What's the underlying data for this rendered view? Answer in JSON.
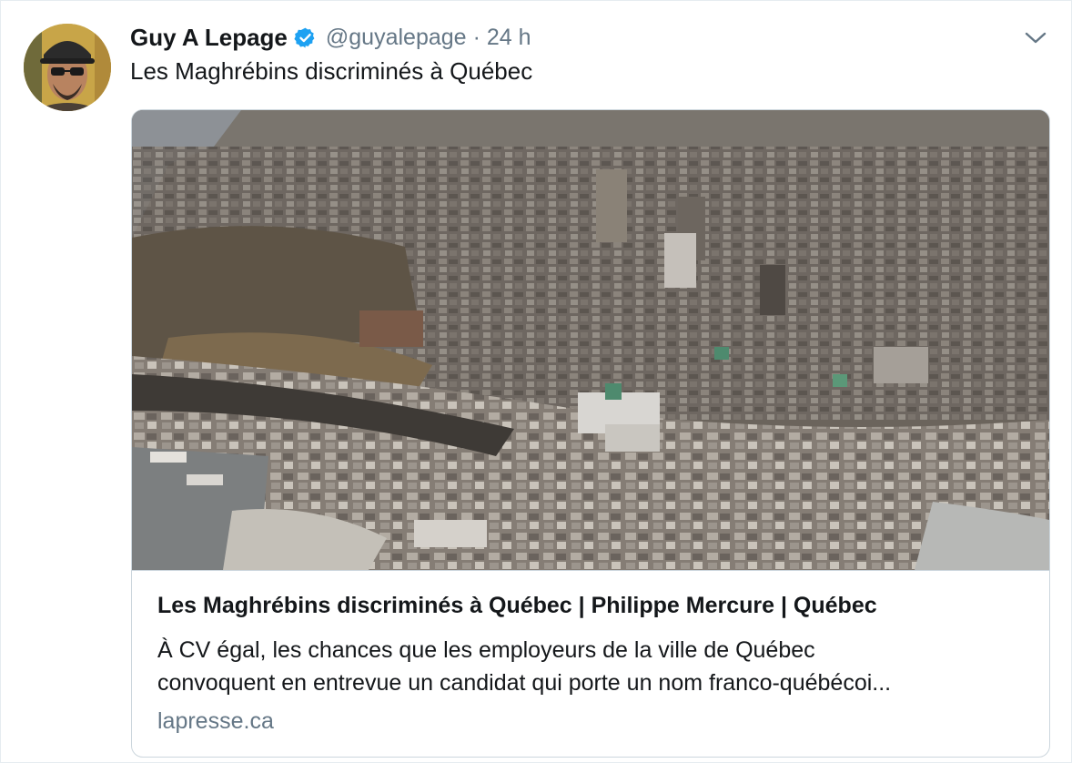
{
  "tweet": {
    "display_name": "Guy A Lepage",
    "handle": "@guyalepage",
    "separator": "·",
    "time": "24 h",
    "text": "Les Maghrébins discriminés à Québec",
    "verified": true,
    "verified_color": "#1da1f2",
    "icons": {
      "verified": "verified-badge-icon",
      "menu": "chevron-down-icon"
    }
  },
  "card": {
    "title": "Les Maghrébins discriminés à Québec | Philippe Mercure | Québec",
    "description_line1": "À CV égal, les chances que les employeurs de la ville de Québec",
    "description_line2": "convoquent en entrevue un candidat qui porte un nom franco-québécoi...",
    "domain": "lapresse.ca"
  },
  "colors": {
    "text": "#14171a",
    "secondary": "#657786",
    "border": "#ccd6dd",
    "accent": "#1da1f2"
  }
}
